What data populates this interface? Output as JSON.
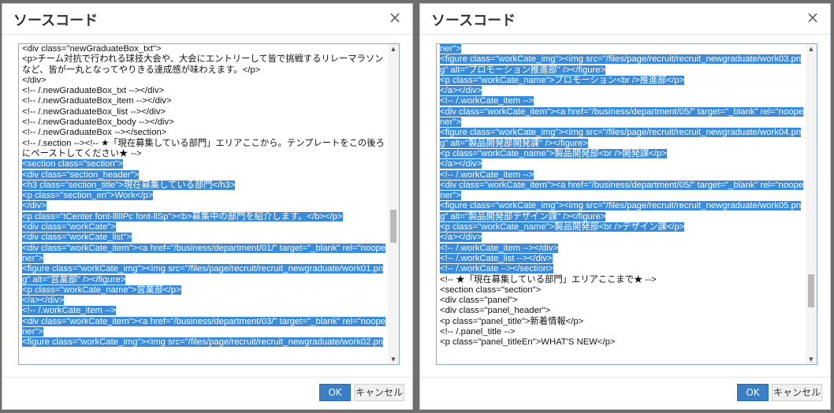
{
  "dialogs": [
    {
      "title": "ソースコード",
      "close": "×",
      "ok_label": "OK",
      "cancel_label": "キャンセル",
      "scroll_thumb": 0.58,
      "lines": [
        {
          "text": "<div class=\"newGraduateBox_txt\">",
          "sel": false
        },
        {
          "text": "<p>チーム対抗で行われる球技大会や、大会にエントリーして皆で挑戦するリレーマラソン",
          "sel": false
        },
        {
          "text": "など、皆が一丸となってやりきる達成感が味わえます。</p>",
          "sel": false
        },
        {
          "text": "</div>",
          "sel": false
        },
        {
          "text": "<!-- /.newGraduateBox_txt --></div>",
          "sel": false
        },
        {
          "text": "<!-- /.newGraduateBox_item --></div>",
          "sel": false
        },
        {
          "text": "<!-- /.newGraduateBox_list --></div>",
          "sel": false
        },
        {
          "text": "<!-- /.newGraduateBox_body --></div>",
          "sel": false
        },
        {
          "text": "<!-- /.newGraduateBox --></section>",
          "sel": false
        },
        {
          "text": "<!-- /.section --><!-- ★「現在募集している部門」エリアここから。テンプレートをこの後ろ",
          "sel": false
        },
        {
          "text": "にペーストしてください★ -->",
          "sel": false
        },
        {
          "text": "<section class=\"section\">",
          "sel": true
        },
        {
          "text": "<div class=\"section_header\">",
          "sel": true
        },
        {
          "text": "<h3 class=\"section_title\">現在募集している部門</h3>",
          "sel": true
        },
        {
          "text": "<p class=\"section_en\">Work</p>",
          "sel": true
        },
        {
          "text": "</div>",
          "sel": true
        },
        {
          "text": "<p class=\"tCenter font-lllllPc font-llSp\"><b>募集中の部門を紹介します。</b></p>",
          "sel": true
        },
        {
          "text": "<div class=\"workCate\">",
          "sel": true
        },
        {
          "text": "<div class=\"workCate_list\">",
          "sel": true
        },
        {
          "text": "<div class=\"workCate_item\"><a href=\"/business/department/01/\" target=\"_blank\" rel=\"noope",
          "sel": true
        },
        {
          "text": "ner\">",
          "sel": true
        },
        {
          "text": "<figure class=\"workCate_img\"><img src=\"/files/page/recruit/recruit_newgraduate/work01.pn",
          "sel": true
        },
        {
          "text": "g\" alt=\"営業部\" /></figure>",
          "sel": true
        },
        {
          "text": "<p class=\"workCate_name\">営業部</p>",
          "sel": true
        },
        {
          "text": "</a></div>",
          "sel": true
        },
        {
          "text": "<!-- /.workCate_item -->",
          "sel": true
        },
        {
          "text": "<div class=\"workCate_item\"><a href=\"/business/department/03/\" target=\"_blank\" rel=\"noope",
          "sel": true
        },
        {
          "text": "ner\">",
          "sel": true
        },
        {
          "text": "<figure class=\"workCate_img\"><img src=\"/files/page/recruit/recruit_newgraduate/work02.pn",
          "sel": true
        }
      ]
    },
    {
      "title": "ソースコード",
      "close": "×",
      "ok_label": "OK",
      "cancel_label": "キャンセル",
      "scroll_thumb": 0.82,
      "lines": [
        {
          "text": "ner\">",
          "sel": true
        },
        {
          "text": "<figure class=\"workCate_img\"><img src=\"/files/page/recruit/recruit_newgraduate/work03.pn",
          "sel": true
        },
        {
          "text": "g\" alt=\"プロモーション推進部\" /></figure>",
          "sel": true
        },
        {
          "text": "<p class=\"workCate_name\">プロモーション<br />推進部</p>",
          "sel": true
        },
        {
          "text": "</a></div>",
          "sel": true
        },
        {
          "text": "<!-- /.workCate_item -->",
          "sel": true
        },
        {
          "text": "<div class=\"workCate_item\"><a href=\"/business/department/05/\" target=\"_blank\" rel=\"noope",
          "sel": true
        },
        {
          "text": "ner\">",
          "sel": true
        },
        {
          "text": "<figure class=\"workCate_img\"><img src=\"/files/page/recruit/recruit_newgraduate/work04.pn",
          "sel": true
        },
        {
          "text": "g\" alt=\"製品開発部開発課\" /></figure>",
          "sel": true
        },
        {
          "text": "<p class=\"workCate_name\">製品開発部<br />開発課</p>",
          "sel": true
        },
        {
          "text": "</a></div>",
          "sel": true
        },
        {
          "text": "<!-- /.workCate_item -->",
          "sel": true
        },
        {
          "text": "<div class=\"workCate_item\"><a href=\"/business/department/05/\" target=\"_blank\" rel=\"noope",
          "sel": true
        },
        {
          "text": "ner\">",
          "sel": true
        },
        {
          "text": "<figure class=\"workCate_img\"><img src=\"/files/page/recruit/recruit_newgraduate/work05.pn",
          "sel": true
        },
        {
          "text": "g\" alt=\"製品開発部デザイン課\" /></figure>",
          "sel": true
        },
        {
          "text": "<p class=\"workCate_name\">製品開発部<br />デザイン課</p>",
          "sel": true
        },
        {
          "text": "</a></div>",
          "sel": true
        },
        {
          "text": "<!-- /.workCate_item --></div>",
          "sel": true
        },
        {
          "text": "<!-- /.workCate_list --></div>",
          "sel": true
        },
        {
          "text": "<!-- /.workCate --></section>",
          "sel": true
        },
        {
          "text": "<!-- ★「現在募集している部門」エリアここまで★ -->",
          "sel": false
        },
        {
          "text": "<section class=\"section\">",
          "sel": false
        },
        {
          "text": "<div class=\"panel\">",
          "sel": false
        },
        {
          "text": "<div class=\"panel_header\">",
          "sel": false
        },
        {
          "text": "<p class=\"panel_title\">新着情報</p>",
          "sel": false
        },
        {
          "text": "<!-- /.panel_title -->",
          "sel": false
        },
        {
          "text": "<p class=\"panel_titleEn\">WHAT'S NEW</p>",
          "sel": false
        }
      ]
    }
  ]
}
